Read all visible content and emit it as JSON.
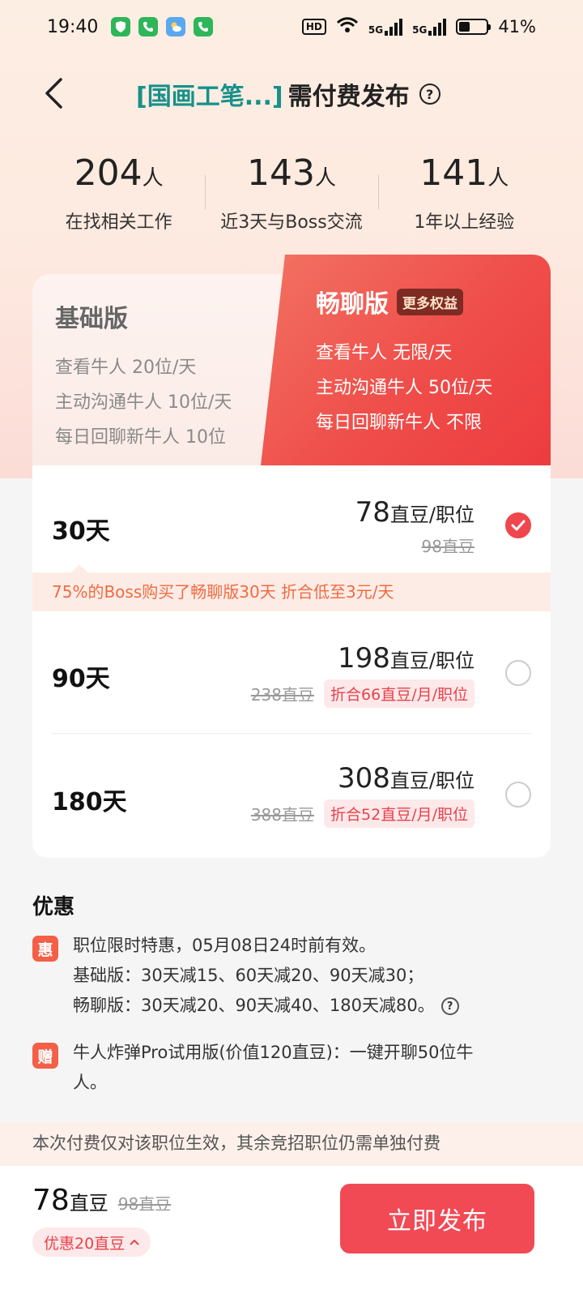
{
  "status_bar": {
    "time": "19:40",
    "battery": "41%",
    "net1": "5G",
    "net2": "5G",
    "hd": "HD"
  },
  "header": {
    "job_tag": "[国画工笔...]",
    "title": "需付费发布",
    "help": "?"
  },
  "stats": [
    {
      "num": "204",
      "unit": "人",
      "label": "在找相关工作"
    },
    {
      "num": "143",
      "unit": "人",
      "label": "近3天与Boss交流"
    },
    {
      "num": "141",
      "unit": "人",
      "label": "1年以上经验"
    }
  ],
  "plans": {
    "basic": {
      "name": "基础版",
      "features": [
        "查看牛人 20位/天",
        "主动沟通牛人 10位/天",
        "每日回聊新牛人 10位"
      ]
    },
    "pro": {
      "name": "畅聊版",
      "badge": "更多权益",
      "features": [
        "查看牛人 无限/天",
        "主动沟通牛人 50位/天",
        "每日回聊新牛人 不限"
      ]
    }
  },
  "options": [
    {
      "days": "30天",
      "price": "78",
      "unit": "直豆/职位",
      "orig": "98直豆",
      "disc": "",
      "selected": true
    },
    {
      "days": "90天",
      "price": "198",
      "unit": "直豆/职位",
      "orig": "238直豆",
      "disc": "折合66直豆/月/职位",
      "selected": false
    },
    {
      "days": "180天",
      "price": "308",
      "unit": "直豆/职位",
      "orig": "388直豆",
      "disc": "折合52直豆/月/职位",
      "selected": false
    }
  ],
  "hint": "75%的Boss购买了畅聊版30天 折合低至3元/天",
  "promos": {
    "title": "优惠",
    "items": [
      {
        "icon": "惠",
        "lines": [
          "职位限时特惠，05月08日24时前有效。",
          "基础版：30天减15、60天减20、90天减30；",
          "畅聊版：30天减20、90天减40、180天减80。"
        ]
      },
      {
        "icon": "赠",
        "lines": [
          "牛人炸弹Pro试用版(价值120直豆)：一键开聊50位牛",
          "人。"
        ]
      }
    ]
  },
  "notice": "本次付费仅对该职位生效，其余竞招职位仍需单独付费",
  "bottom": {
    "total": "78",
    "total_unit": "直豆",
    "orig": "98直豆",
    "save": "优惠20直豆",
    "publish": "立即发布"
  },
  "colors": {
    "accent": "#f14a55",
    "job_tag": "#16918a",
    "hint_text": "#ef6b42"
  }
}
